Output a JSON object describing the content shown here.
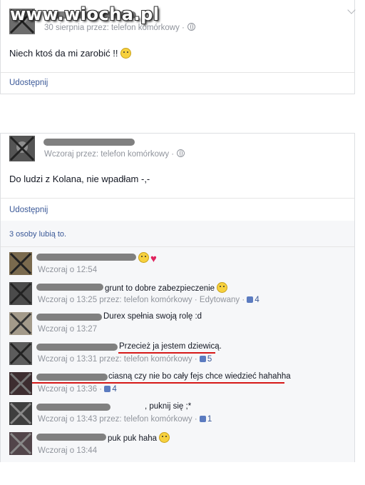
{
  "watermark": "www.wiocha.pl",
  "post1": {
    "meta": "30 sierpnia przez: telefon komórkowy ·",
    "text": "Niech ktoś da mi zarobić !!",
    "share": "Udostępnij"
  },
  "post2": {
    "meta": "Wczoraj przez: telefon komórkowy ·",
    "text": "Do ludzi z Kolana, nie wpadłam -,-",
    "share": "Udostępnij",
    "likes": "3 osoby lubią to."
  },
  "comments": [
    {
      "text": "",
      "time": "Wczoraj o 12:54",
      "extra": ""
    },
    {
      "text": "grunt to dobre zabezpieczenie",
      "time": "Wczoraj o 13:25 przez: telefon komórkowy · Edytowany ·",
      "likes": "4"
    },
    {
      "text": "Durex spełnia swoją rolę :d",
      "time": "Wczoraj o 13:27",
      "extra": ""
    },
    {
      "text": "Przecież ja jestem dziewicą.",
      "time": "Wczoraj o 13:31 przez: telefon komórkowy ·",
      "likes": "5"
    },
    {
      "text": "ciasną czy nie bo cały fejs chce wiedzieć hahahha",
      "time": "Wczoraj o 13:36 ·",
      "likes": "4"
    },
    {
      "text": ", puknij się ;*",
      "time": "Wczoraj o 13:43 przez: telefon komórkowy ·",
      "likes": "1"
    },
    {
      "text": "puk puk haha",
      "time": "Wczoraj o 13:44",
      "extra": ""
    }
  ],
  "colors": {
    "link": "#3b5998",
    "meta": "#90949c",
    "underline": "#d61818"
  }
}
